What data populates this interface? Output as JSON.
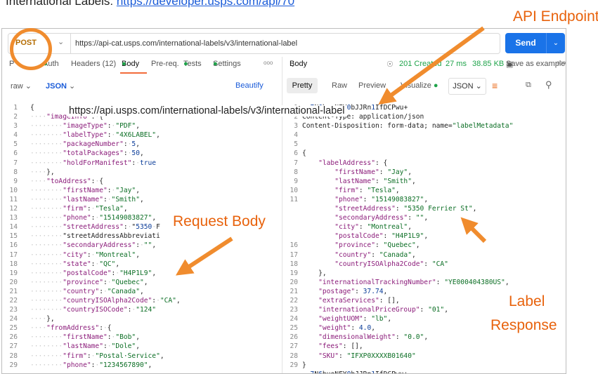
{
  "caption": {
    "prefix": "International Labels: ",
    "link": "https://developer.usps.com/api/70"
  },
  "request": {
    "method": "POST",
    "url": "https://api-cat.usps.com/international-labels/v3/international-label",
    "send_label": "Send"
  },
  "left_tabs": {
    "params_partial": "P",
    "auth": "Auth",
    "headers": "Headers (12)",
    "body": "Body",
    "prereq": "Pre-req.",
    "tests": "Tests",
    "settings": "Settings",
    "more": "ooo"
  },
  "left_toolbar": {
    "raw": "raw",
    "json": "JSON",
    "beautify": "Beautify"
  },
  "right_tabs": {
    "body": "Body",
    "status": "201 Created",
    "time": "27 ms",
    "size": "38.85 KB",
    "save": "Save as example",
    "more": "ooo"
  },
  "right_toolbar": {
    "pretty": "Pretty",
    "raw": "Raw",
    "preview": "Preview",
    "visualize": "Visualize",
    "json": "JSON"
  },
  "overlay_url": "https://api.usps.com/international-labels/v3/international-label",
  "annotations": {
    "api_endpoint": "API Endpoint",
    "request_body": "Request Body",
    "label_line1": "Label",
    "label_line2": "Response"
  },
  "request_body_lines": [
    "{",
    "····\"imageInfo\":·{",
    "········\"imageType\":·\"PDF\",",
    "········\"labelType\":·\"4X6LABEL\",",
    "········\"packageNumber\":·5,",
    "········\"totalPackages\":·50,",
    "········\"holdForManifest\":·true",
    "····},",
    "····\"toAddress\":·{",
    "········\"firstName\":·\"Jay\",",
    "········\"lastName\":·\"Smith\",",
    "········\"firm\":·\"Tesla\",",
    "········\"phone\":·\"15149083827\",",
    "········\"streetAddress\":·\"5350·F",
    "········\"streetAddressAbbreviati",
    "········\"secondaryAddress\":·\"\",",
    "········\"city\":·\"Montreal\",",
    "········\"state\":·\"QC\",",
    "········\"postalCode\":·\"H4P1L9\",",
    "········\"province\":·\"Quebec\",",
    "········\"country\":·\"Canada\",",
    "········\"countryISOAlpha2Code\":·\"CA\",",
    "········\"countryISOCode\":·\"124\"",
    "····},",
    "····\"fromAddress\":·{",
    "········\"firstName\":·\"Bob\",",
    "········\"lastName\":·\"Dole\",",
    "········\"firm\":·\"Postal·Service\",",
    "········\"phone\":·\"1234567890\","
  ],
  "response_lines": [
    "--7N6buoNFY0bJJRn1IfDCPwu+",
    "Content-Type: application/json",
    "Content-Disposition: form-data; name=\"labelMetadata\"",
    "",
    "",
    "{",
    "    \"labelAddress\": {",
    "        \"firstName\": \"Jay\",",
    "        \"lastName\": \"Smith\",",
    "        \"firm\": \"Tesla\",",
    "        \"phone\": \"15149083827\",",
    "        \"streetAddress\": \"5350 Ferrier St\",",
    "        \"secondaryAddress\": \"\",",
    "        \"city\": \"Montreal\",",
    "        \"postalCode\": \"H4P1L9\",",
    "        \"province\": \"Quebec\",",
    "        \"country\": \"Canada\",",
    "        \"countryISOAlpha2Code\": \"CA\"",
    "    },",
    "    \"internationalTrackingNumber\": \"YE000404380US\",",
    "    \"postage\": 37.74,",
    "    \"extraServices\": [],",
    "    \"internationalPriceGroup\": \"01\",",
    "    \"weightUOM\": \"lb\",",
    "    \"weight\": 4.0,",
    "    \"dimensionalWeight\": \"0.0\",",
    "    \"fees\": [],",
    "    \"SKU\": \"IFXP0XXXXB01640\"",
    "}",
    "--7N6buoNFY0bJJRn1IfDCPwu+"
  ],
  "response_line_numbers": [
    "1",
    "2",
    "3",
    "4",
    "5",
    "6",
    "7",
    "8",
    "9",
    "10",
    "11",
    "",
    "",
    "",
    "",
    "16",
    "17",
    "18",
    "19",
    "20",
    "21",
    "22",
    "23",
    "24",
    "25",
    "26",
    "27",
    "28",
    "29",
    ""
  ],
  "colors": {
    "accent": "#e8620c",
    "send": "#1a73e8",
    "status_green": "#1fa34a",
    "method": "#b36b00"
  }
}
